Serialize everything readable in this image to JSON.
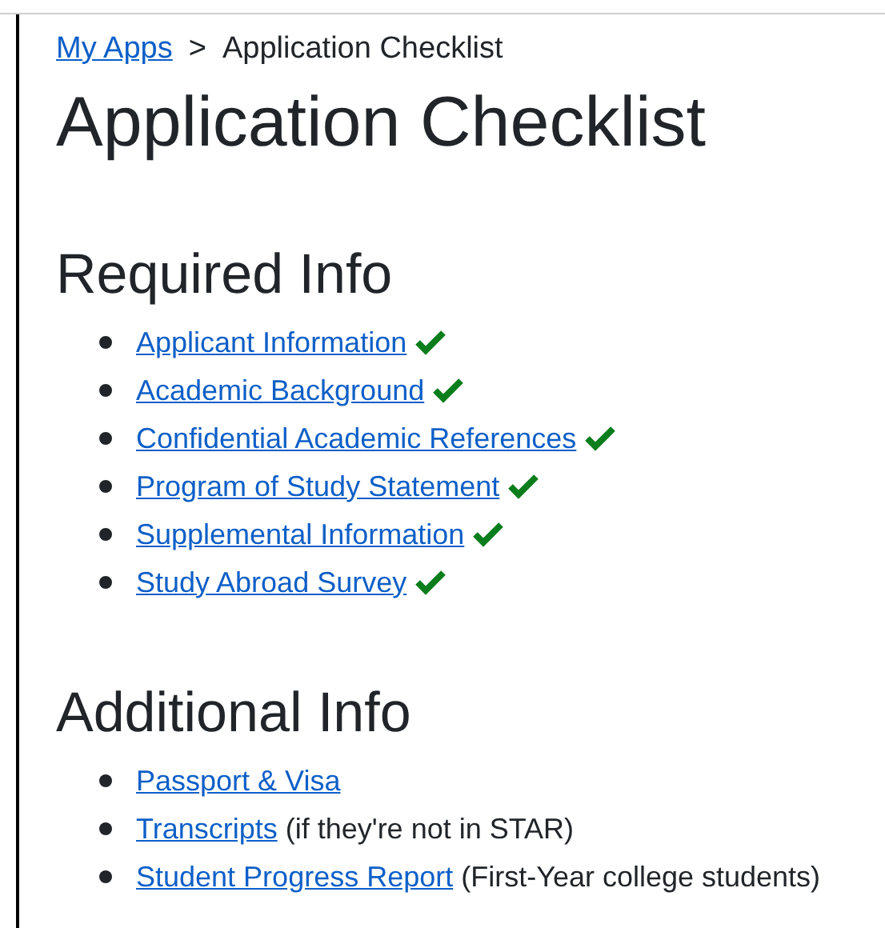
{
  "breadcrumb": [
    {
      "label": "My Apps",
      "link": true
    },
    {
      "label": ">",
      "link": false
    },
    {
      "label": "Application Checklist",
      "link": false
    }
  ],
  "title": "Application Checklist",
  "sections": [
    {
      "heading": "Required Info",
      "items": [
        {
          "label": "Applicant Information",
          "completed": true
        },
        {
          "label": "Academic Background",
          "completed": true
        },
        {
          "label": "Confidential Academic References",
          "completed": true
        },
        {
          "label": "Program of Study Statement",
          "completed": true
        },
        {
          "label": "Supplemental Information",
          "completed": true
        },
        {
          "label": "Study Abroad Survey",
          "completed": true
        }
      ]
    },
    {
      "heading": "Additional Info",
      "items": [
        {
          "label": "Passport & Visa",
          "completed": false
        },
        {
          "label": "Transcripts",
          "note": "(if they're not in STAR)",
          "completed": false
        },
        {
          "label": "Student Progress Report",
          "note": "(First-Year college students)",
          "completed": false
        }
      ]
    }
  ]
}
